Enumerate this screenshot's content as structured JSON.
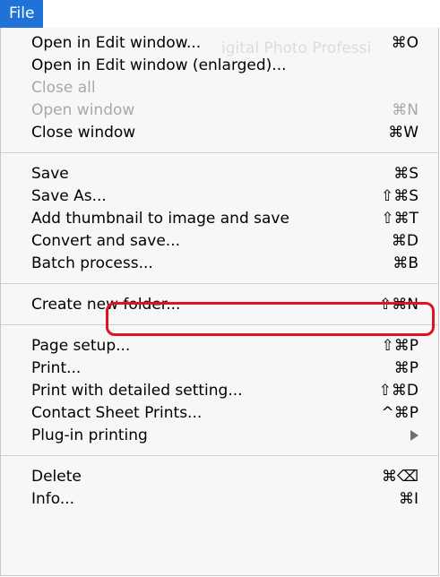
{
  "menu": {
    "title": "File",
    "background_watermark": "igital Photo Professi"
  },
  "groups": [
    [
      {
        "label": "Open in Edit window...",
        "shortcut": "⌘O",
        "disabled": false
      },
      {
        "label": "Open in Edit window (enlarged)...",
        "shortcut": "",
        "disabled": false
      },
      {
        "label": "Close all",
        "shortcut": "",
        "disabled": true
      },
      {
        "label": "Open window",
        "shortcut": "⌘N",
        "disabled": true
      },
      {
        "label": "Close window",
        "shortcut": "⌘W",
        "disabled": false
      }
    ],
    [
      {
        "label": "Save",
        "shortcut": "⌘S",
        "disabled": false
      },
      {
        "label": "Save As...",
        "shortcut": "⇧⌘S",
        "disabled": false
      },
      {
        "label": "Add thumbnail to image and save",
        "shortcut": "⇧⌘T",
        "disabled": false,
        "highlighted": true
      },
      {
        "label": "Convert and save...",
        "shortcut": "⌘D",
        "disabled": false
      },
      {
        "label": "Batch process...",
        "shortcut": "⌘B",
        "disabled": false
      }
    ],
    [
      {
        "label": "Create new folder...",
        "shortcut": "⇧⌘N",
        "disabled": false
      }
    ],
    [
      {
        "label": "Page setup...",
        "shortcut": "⇧⌘P",
        "disabled": false
      },
      {
        "label": "Print...",
        "shortcut": "⌘P",
        "disabled": false
      },
      {
        "label": "Print with detailed setting...",
        "shortcut": "⇧⌘D",
        "disabled": false
      },
      {
        "label": "Contact Sheet Prints...",
        "shortcut": "^⌘P",
        "disabled": false
      },
      {
        "label": "Plug-in printing",
        "shortcut": "",
        "submenu": true,
        "disabled": false
      }
    ],
    [
      {
        "label": "Delete",
        "shortcut": "⌘⌫",
        "disabled": false
      },
      {
        "label": "Info...",
        "shortcut": "⌘I",
        "disabled": false
      }
    ]
  ],
  "colors": {
    "menu_title_bg": "#1f73d6",
    "highlight_border": "#e0141e",
    "disabled_text": "#a8a8a8"
  }
}
